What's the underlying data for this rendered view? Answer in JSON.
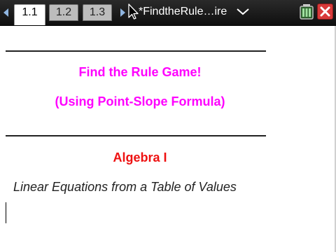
{
  "titlebar": {
    "tabs": [
      {
        "label": "1.1",
        "active": true
      },
      {
        "label": "1.2",
        "active": false
      },
      {
        "label": "1.3",
        "active": false
      }
    ],
    "document_name": "*FindtheRule…ire",
    "icons": [
      "arrow-left-icon",
      "arrow-right-icon",
      "cursor-icon",
      "chevron-down-icon",
      "battery-icon",
      "close-icon"
    ]
  },
  "content": {
    "title_line_1": "Find the Rule Game!",
    "title_line_2": "(Using Point-Slope Formula)",
    "subject": "Algebra I",
    "subtitle": "Linear Equations from a Table of  Values"
  },
  "colors": {
    "title": "#ff00ff",
    "subject": "#ee1111",
    "titlebar": "#1a1a1a",
    "close_button": "#d83a3a"
  }
}
